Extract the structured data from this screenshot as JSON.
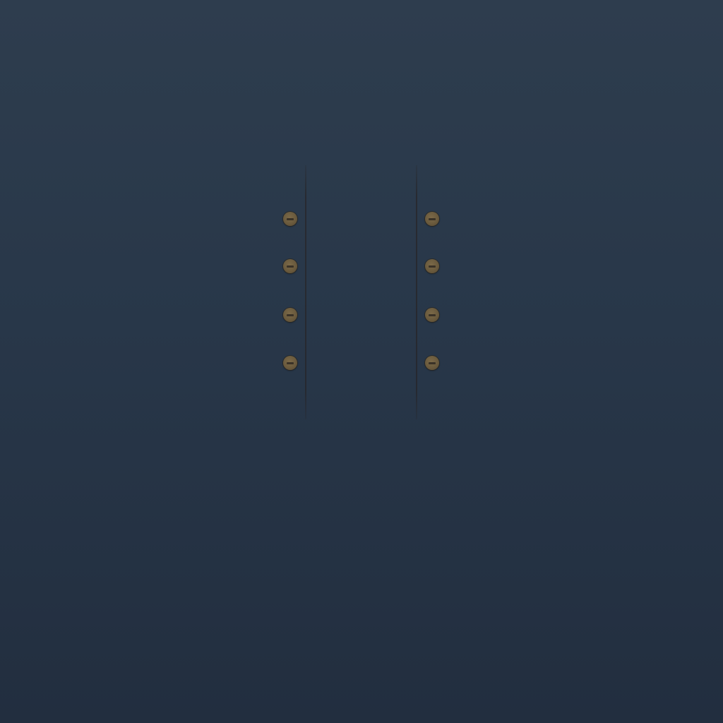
{
  "scene": {
    "background_top": "#2e3d4e",
    "background_bottom": "#222e3f",
    "accent_screw": "#6a5a3d",
    "rail_color": "#261e1c"
  },
  "left_column": {
    "screws": [
      {
        "icon": "screw-icon"
      },
      {
        "icon": "screw-icon"
      },
      {
        "icon": "screw-icon"
      },
      {
        "icon": "screw-icon"
      }
    ]
  },
  "right_column": {
    "screws": [
      {
        "icon": "screw-icon"
      },
      {
        "icon": "screw-icon"
      },
      {
        "icon": "screw-icon"
      },
      {
        "icon": "screw-icon"
      }
    ]
  }
}
